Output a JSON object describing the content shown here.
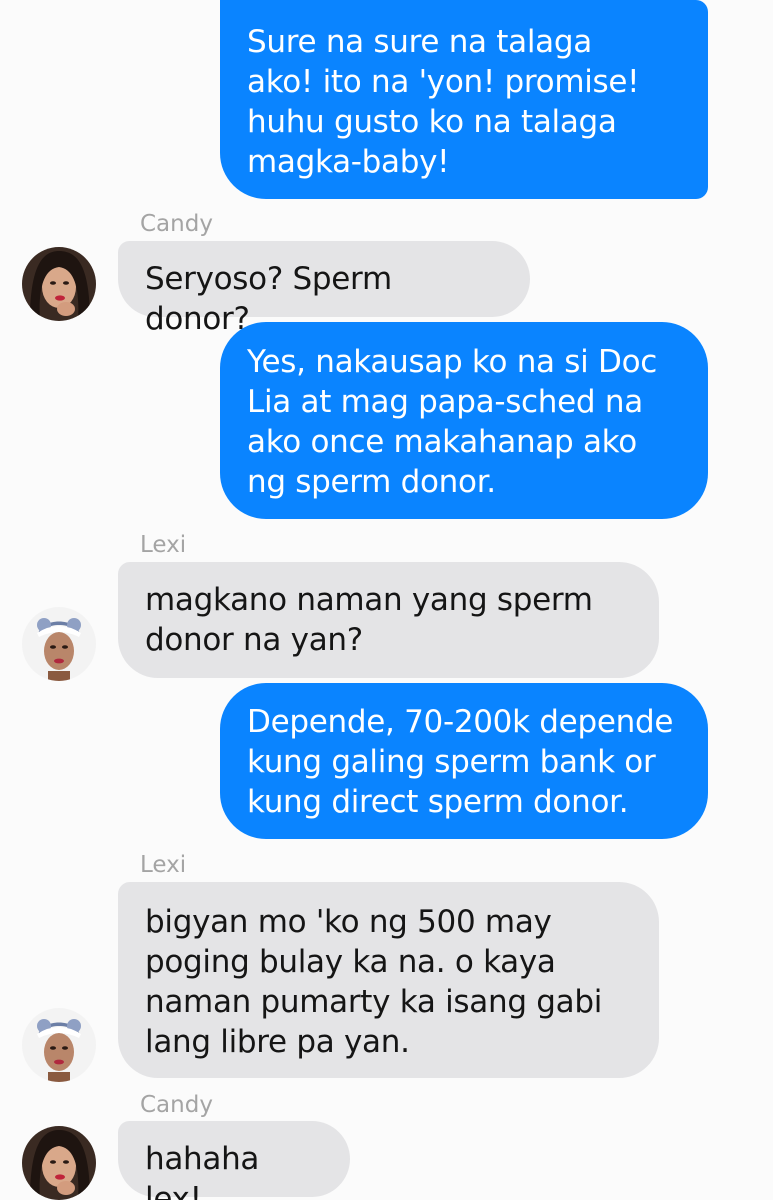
{
  "conversation": {
    "messages": [
      {
        "type": "sent",
        "text": "Sure na sure na talaga\nako! ito na 'yon! promise!\nhuhu gusto ko na talaga\nmagka-baby!"
      },
      {
        "type": "sender",
        "text": "Candy"
      },
      {
        "type": "received",
        "text": "Seryoso? Sperm donor?",
        "avatar": "candy-avatar"
      },
      {
        "type": "sent",
        "text": "Yes, nakausap ko na si Doc\nLia at mag papa-sched na\nako once makahanap ako\nng sperm donor."
      },
      {
        "type": "sender",
        "text": "Lexi"
      },
      {
        "type": "received",
        "text": "magkano naman yang sperm\ndonor na yan?",
        "avatar": "lexi-avatar"
      },
      {
        "type": "sent",
        "text": "Depende, 70-200k depende\nkung galing sperm bank or\nkung direct sperm donor."
      },
      {
        "type": "sender",
        "text": "Lexi"
      },
      {
        "type": "received",
        "text": "bigyan mo 'ko ng 500 may\npoging bulay ka na. o kaya\nnaman pumarty ka isang gabi\nlang libre pa yan.",
        "avatar": "lexi-avatar"
      },
      {
        "type": "sender",
        "text": "Candy"
      },
      {
        "type": "received",
        "text": "hahaha lex!",
        "avatar": "candy-avatar"
      }
    ]
  },
  "colors": {
    "sent_bubble": "#0a84ff",
    "received_bubble": "#e4e4e6",
    "sender_name": "#a4a4a4",
    "background": "#fbfbfb"
  }
}
